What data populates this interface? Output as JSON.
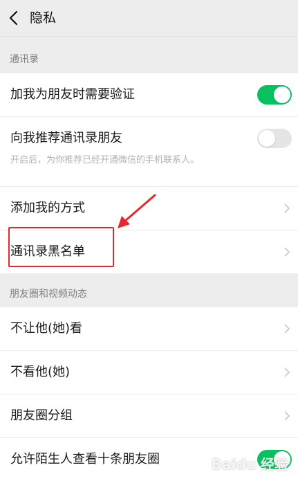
{
  "header": {
    "title": "隐私"
  },
  "sections": [
    {
      "title": "通讯录",
      "rows": [
        {
          "label": "加我为朋友时需要验证",
          "toggle": "on"
        },
        {
          "label": "向我推荐通讯录朋友",
          "sub": "开启后，为你推荐已经开通微信的手机联系人。",
          "toggle": "off"
        },
        {
          "label": "添加我的方式"
        },
        {
          "label": "通讯录黑名单"
        }
      ]
    },
    {
      "title": "朋友圈和视频动态",
      "rows": [
        {
          "label": "不让他(她)看"
        },
        {
          "label": "不看他(她)"
        },
        {
          "label": "朋友圈分组"
        },
        {
          "label": "允许陌生人查看十条朋友圈",
          "toggle": "on"
        }
      ]
    }
  ],
  "colors": {
    "toggle_on": "#07c160",
    "toggle_off": "#e5e5e5",
    "annotation": "#e8272b"
  },
  "icons": {
    "back": "chevron-left-icon",
    "row_arrow": "chevron-right-icon"
  },
  "watermark": "Baidu 经验"
}
